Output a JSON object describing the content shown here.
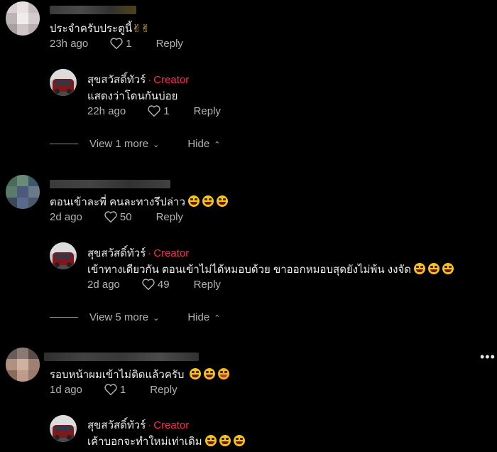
{
  "colors": {
    "background": "#000000",
    "creator_tag": "#fe2c55",
    "muted": "#b3b3b3",
    "text": "#eeeeee"
  },
  "comments": [
    {
      "text": "ประจำครับประตูนี้",
      "emoji_icons": [
        "victory-hand-icon",
        "victory-hand-icon"
      ],
      "time": "23h ago",
      "likes": "1",
      "reply_label": "Reply",
      "creator_reply": {
        "name": "สุขสวัสดิ์ทัวร์",
        "dot": "·",
        "tag": "Creator",
        "text": "แสดงว่าโดนกันบ่อย",
        "time": "22h ago",
        "likes": "1",
        "reply_label": "Reply"
      },
      "view_more": "View 1 more",
      "hide": "Hide"
    },
    {
      "text": "ตอนเข้าละพี่ คนละทางรึปล่าว",
      "emoji_icons": [
        "grin-sweat-icon",
        "grin-sweat-icon",
        "grin-sweat-icon"
      ],
      "time": "2d ago",
      "likes": "50",
      "reply_label": "Reply",
      "creator_reply": {
        "name": "สุขสวัสดิ์ทัวร์",
        "dot": "·",
        "tag": "Creator",
        "text": "เข้าทางเดียวกัน ตอนเข้าไม่ได้หมอบด้วย ขาออกหมอบสุดยังไม่พ้น งงจัด",
        "time": "2d ago",
        "likes": "49",
        "reply_label": "Reply"
      },
      "view_more": "View 5 more",
      "hide": "Hide"
    },
    {
      "text": "รอบหน้าผมเข้าไม่ติดแล้วครับ",
      "emoji_icons": [
        "grin-sweat-icon",
        "laugh-tears-icon",
        "tongue-wink-icon"
      ],
      "time": "1d ago",
      "likes": "1",
      "reply_label": "Reply",
      "creator_reply": {
        "name": "สุขสวัสดิ์ทัวร์",
        "dot": "·",
        "tag": "Creator",
        "text": "เค้าบอกจะทำใหม่เท่าเดิม"
      }
    }
  ],
  "more_options": "•••"
}
